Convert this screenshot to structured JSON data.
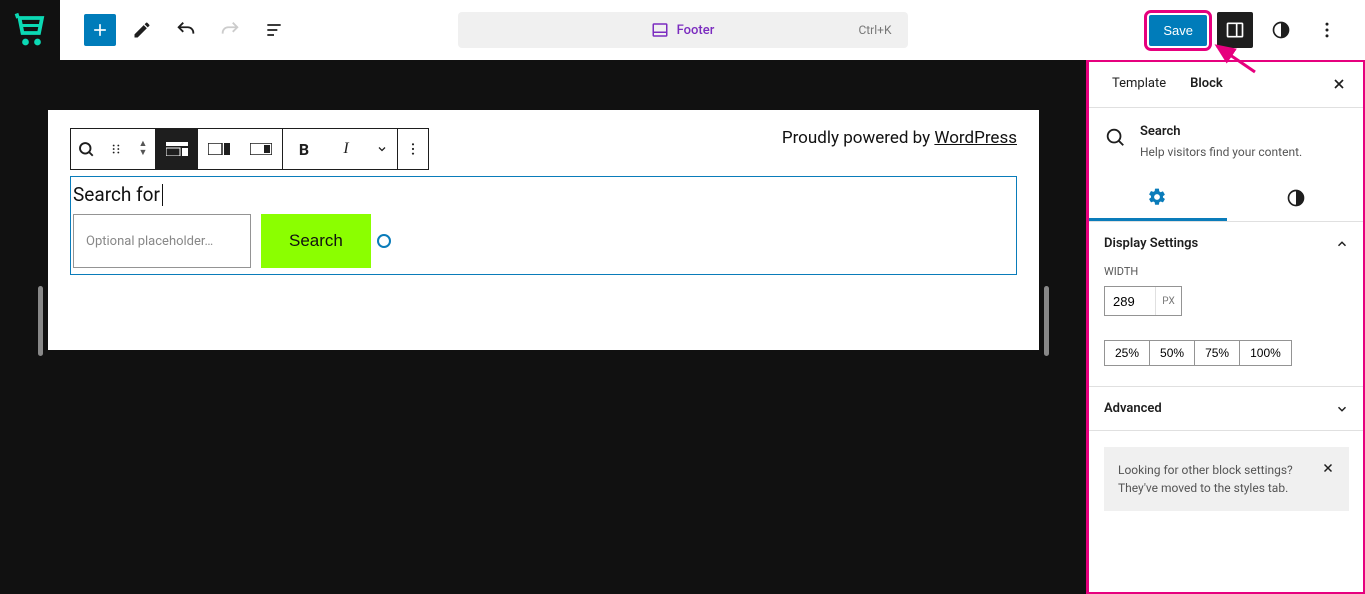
{
  "header": {
    "doc_title": "Footer",
    "shortcut": "Ctrl+K",
    "save_label": "Save"
  },
  "canvas": {
    "powered_prefix": "Proudly powered by ",
    "powered_link": "WordPress",
    "search_block": {
      "label_text": "Search for",
      "placeholder_text": "Optional placeholder…",
      "button_label": "Search"
    }
  },
  "sidebar": {
    "tabs": {
      "template": "Template",
      "block": "Block"
    },
    "block_info": {
      "title": "Search",
      "description": "Help visitors find your content."
    },
    "display_settings": {
      "title": "Display Settings",
      "width_label": "Width",
      "width_value": "289",
      "width_unit": "PX",
      "percent_options": [
        "25%",
        "50%",
        "75%",
        "100%"
      ]
    },
    "advanced": {
      "title": "Advanced"
    },
    "notice": {
      "text": "Looking for other block settings? They've moved to the styles tab."
    }
  }
}
